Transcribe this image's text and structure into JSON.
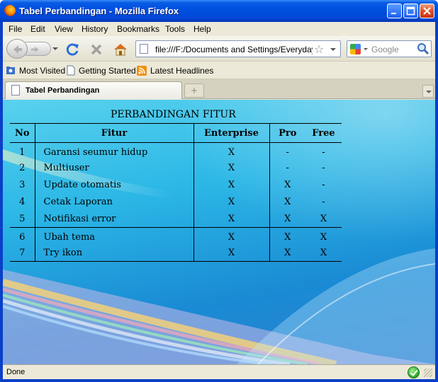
{
  "window": {
    "title": "Tabel Perbandingan - Mozilla Firefox"
  },
  "menu": [
    "File",
    "Edit",
    "View",
    "History",
    "Bookmarks",
    "Tools",
    "Help"
  ],
  "navigation": {
    "url": "file:///F:/Documents and Settings/Everyday L",
    "search_placeholder": "Google"
  },
  "bookmarks": [
    "Most Visited",
    "Getting Started",
    "Latest Headlines"
  ],
  "tab": {
    "label": "Tabel Perbandingan",
    "new_tab_glyph": "+"
  },
  "table": {
    "title": "PERBANDINGAN FITUR",
    "headers": [
      "No",
      "Fitur",
      "Enterprise",
      "Pro",
      "Free"
    ],
    "rows": [
      [
        "1",
        "Garansi seumur hidup",
        "X",
        "-",
        "-"
      ],
      [
        "2",
        "Multiuser",
        "X",
        "-",
        "-"
      ],
      [
        "3",
        "Update otomatis",
        "X",
        "X",
        "-"
      ],
      [
        "4",
        "Cetak Laporan",
        "X",
        "X",
        "-"
      ],
      [
        "5",
        "Notifikasi error",
        "X",
        "X",
        "X"
      ],
      [
        "6",
        "Ubah tema",
        "X",
        "X",
        "X"
      ],
      [
        "7",
        "Try ikon",
        "X",
        "X",
        "X"
      ]
    ]
  },
  "status": {
    "text": "Done"
  },
  "icons": {
    "app": "firefox-icon",
    "back": "back-arrow-icon",
    "forward": "forward-arrow-icon",
    "reload": "reload-icon",
    "stop": "stop-icon",
    "home": "home-icon",
    "bookmark_star": "star-icon",
    "search_engine": "google-icon",
    "search_go": "magnifier-icon",
    "status_ok": "check-icon"
  },
  "colors": {
    "titlebar": "#0050e0",
    "chrome": "#ece9d8",
    "page_background": "#2bb7e6",
    "close_button": "#e0502a"
  }
}
